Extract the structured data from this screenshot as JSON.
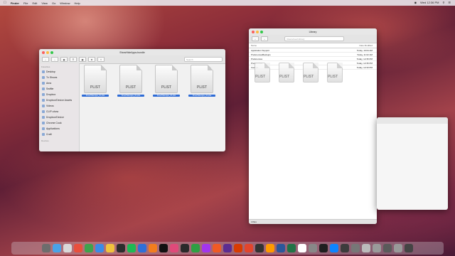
{
  "menubar": {
    "app": "Finder",
    "items": [
      "File",
      "Edit",
      "View",
      "Go",
      "Window",
      "Help"
    ],
    "clock": "Wed 12:36 PM"
  },
  "finder": {
    "title": "ShowHideApps.bundle",
    "search_placeholder": "Search",
    "sidebar_header_favorites": "Favorites",
    "sidebar_items": [
      "Desktop",
      "Tv Shows",
      "Ama",
      "Swiftie",
      "Dropbox",
      "Dropbox/Device Assets",
      "Videos",
      "CLIP-show",
      "Dropbox/Device",
      "Chrome Cook",
      "Applications",
      "Craft"
    ],
    "sidebar_header_devices": "Devices",
    "files": [
      {
        "name": "ShowHideApps_01.plist",
        "type": "PLIST"
      },
      {
        "name": "ShowHideApps_02.plist",
        "type": "PLIST"
      },
      {
        "name": "ShowHideApps_03.plist",
        "type": "PLIST"
      },
      {
        "name": "ShowHideApps_04.plist",
        "type": "PLIST"
      }
    ]
  },
  "library": {
    "title": "Library",
    "path": "/Users/user/Library",
    "columns": [
      "Name",
      "Date Modified"
    ],
    "rows": [
      {
        "name": "Application Support",
        "date": "Today, 10:04 AM"
      },
      {
        "name": "PreferencesBackups",
        "date": "Today, 11:02 AM"
      },
      {
        "name": "Preferences",
        "date": "Today, 12:35 PM"
      },
      {
        "name": "Preferences",
        "date": "Today, 12:35 PM"
      },
      {
        "name": "Caches",
        "date": "Today, 12:33 PM"
      }
    ],
    "status": "4 files"
  },
  "dock_colors": [
    "#6d6d6d",
    "#4aa3e8",
    "#d9d9d9",
    "#e94f3d",
    "#3fa34d",
    "#3b8be8",
    "#f1c33d",
    "#2d2d2d",
    "#1db954",
    "#2f6fd8",
    "#f27d1e",
    "#111111",
    "#e04a7a",
    "#2a2a2a",
    "#2ea043",
    "#a335ee",
    "#f05a24",
    "#5c2d91",
    "#d83b01",
    "#e3452d",
    "#333333",
    "#ff9a00",
    "#2b579a",
    "#217346",
    "#ffffff",
    "#888888",
    "#1f1f1f",
    "#0b84ff",
    "#3c3c3c",
    "#777777",
    "#bbbbbb",
    "#9a9a9a",
    "#5a5a5a",
    "#999999",
    "#444444"
  ]
}
